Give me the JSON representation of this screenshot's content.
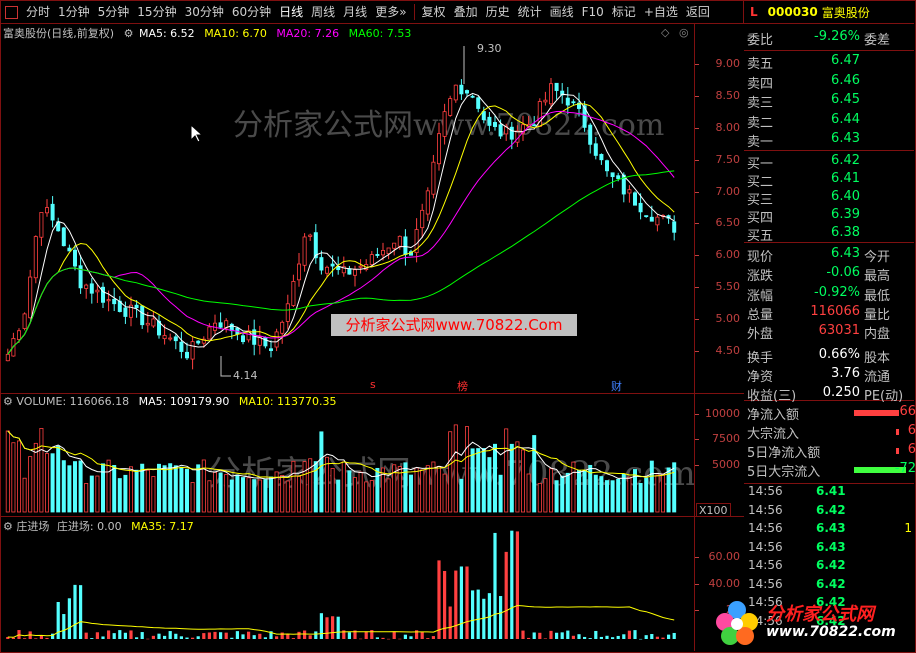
{
  "toolbar": {
    "periods": [
      "分时",
      "1分钟",
      "5分钟",
      "15分钟",
      "30分钟",
      "60分钟",
      "日线",
      "周线",
      "月线",
      "更多"
    ],
    "active_period": "日线",
    "more_arrow": "»",
    "tools": [
      "复权",
      "叠加",
      "历史",
      "统计",
      "画线",
      "F10",
      "标记",
      "+自选",
      "返回"
    ]
  },
  "quote_header": {
    "flag": "L",
    "code": "000030",
    "name": "富奥股份"
  },
  "main_chart": {
    "title": "富奥股份(日线,前复权)",
    "ma5": "MA5: 6.52",
    "ma10": "MA10: 6.70",
    "ma20": "MA20: 7.26",
    "ma60": "MA60: 7.53",
    "high_label": "9.30",
    "low_label": "4.14",
    "axis_ticks": [
      "9.00",
      "8.50",
      "8.00",
      "7.50",
      "7.00",
      "6.50",
      "6.00",
      "5.50",
      "5.00",
      "4.50"
    ],
    "marker_s": "s",
    "marker_bang": "榜",
    "marker_cai": "财"
  },
  "volume_chart": {
    "title": "VOLUME: 116066.18",
    "ma5": "MA5: 109179.90",
    "ma10": "MA10: 113770.35",
    "axis_ticks": [
      "10000",
      "7500",
      "5000"
    ],
    "unit": "X100"
  },
  "indicator_chart": {
    "title": "庄进场",
    "value": "庄进场: 0.00",
    "ma35": "MA35: 7.17",
    "axis_ticks": [
      "60.00",
      "40.00",
      "20"
    ]
  },
  "caption": "分析家公式网www.70822.Com",
  "watermarks": {
    "main": "分析家公式网www.70822.com",
    "volume": "分析家公式网www.70822.com"
  },
  "order_book": {
    "ratio_label": "委比",
    "ratio_value": "-9.26%",
    "diff_label": "委差",
    "sells": [
      {
        "label": "卖五",
        "price": "6.47"
      },
      {
        "label": "卖四",
        "price": "6.46"
      },
      {
        "label": "卖三",
        "price": "6.45"
      },
      {
        "label": "卖二",
        "price": "6.44"
      },
      {
        "label": "卖一",
        "price": "6.43"
      }
    ],
    "buys": [
      {
        "label": "买一",
        "price": "6.42"
      },
      {
        "label": "买二",
        "price": "6.41"
      },
      {
        "label": "买三",
        "price": "6.40"
      },
      {
        "label": "买四",
        "price": "6.39"
      },
      {
        "label": "买五",
        "price": "6.38"
      }
    ]
  },
  "stats": [
    {
      "k": "现价",
      "v": "6.43",
      "k2": "今开"
    },
    {
      "k": "涨跌",
      "v": "-0.06",
      "k2": "最高"
    },
    {
      "k": "涨幅",
      "v": "-0.92%",
      "k2": "最低"
    },
    {
      "k": "总量",
      "v": "116066",
      "k2": "量比"
    },
    {
      "k": "外盘",
      "v": "63031",
      "k2": "内盘"
    },
    {
      "k": "换手",
      "v": "0.66%",
      "k2": "股本"
    },
    {
      "k": "净资",
      "v": "3.76",
      "k2": "流通"
    },
    {
      "k": "收益(三)",
      "v": "0.250",
      "k2": "PE(动)"
    }
  ],
  "flows": [
    {
      "label": "净流入额",
      "value": "66"
    },
    {
      "label": "大宗流入",
      "value": "6"
    },
    {
      "label": "5日净流入额",
      "value": "6"
    },
    {
      "label": "5日大宗流入",
      "value": "-72"
    }
  ],
  "ticks": [
    {
      "time": "14:56",
      "price": "6.41",
      "qty": ""
    },
    {
      "time": "14:56",
      "price": "6.42",
      "qty": ""
    },
    {
      "time": "14:56",
      "price": "6.43",
      "qty": "1"
    },
    {
      "time": "14:56",
      "price": "6.43",
      "qty": ""
    },
    {
      "time": "14:56",
      "price": "6.42",
      "qty": ""
    },
    {
      "time": "14:56",
      "price": "6.42",
      "qty": ""
    },
    {
      "time": "14:56",
      "price": "6.42",
      "qty": ""
    },
    {
      "time": "14:56",
      "price": "6.42",
      "qty": ""
    }
  ],
  "logo": {
    "brand": "分析家公式网",
    "url": "www.70822.com"
  },
  "colors": {
    "up": "#ff4040",
    "down": "#54ffff",
    "ma5": "#ffffff",
    "ma10": "#ffff00",
    "ma20": "#ff00ff",
    "ma60": "#00ff00",
    "border": "#7f1010"
  }
}
